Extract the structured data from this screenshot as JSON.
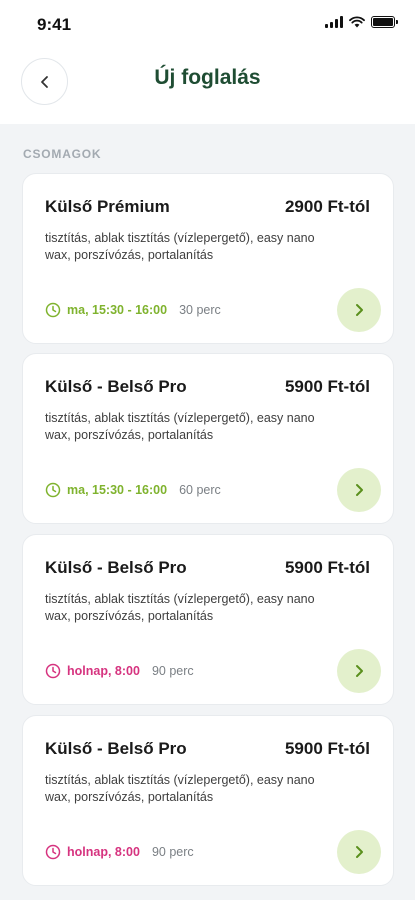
{
  "status_bar": {
    "time": "9:41"
  },
  "header": {
    "title": "Új foglalás"
  },
  "section": {
    "label": "CSOMAGOK"
  },
  "colors": {
    "accent_green": "#7fb32e",
    "accent_pink": "#d6337f",
    "title_green": "#1f4d33",
    "button_bg": "#e3f0cc"
  },
  "packages": [
    {
      "name": "Külső Prémium",
      "price": "2900 Ft-tól",
      "description": "tisztítás, ablak tisztítás (vízlepergető), easy nano wax, porszívózás, portalanítás",
      "when": "ma, 15:30 - 16:00",
      "duration": "30 perc",
      "status": "green"
    },
    {
      "name": "Külső - Belső Pro",
      "price": "5900 Ft-tól",
      "description": "tisztítás, ablak tisztítás (vízlepergető), easy nano wax, porszívózás, portalanítás",
      "when": "ma, 15:30 - 16:00",
      "duration": "60 perc",
      "status": "green"
    },
    {
      "name": "Külső - Belső Pro",
      "price": "5900 Ft-tól",
      "description": "tisztítás, ablak tisztítás (vízlepergető), easy nano wax, porszívózás, portalanítás",
      "when": "holnap, 8:00",
      "duration": "90 perc",
      "status": "pink"
    },
    {
      "name": "Külső - Belső Pro",
      "price": "5900 Ft-tól",
      "description": "tisztítás, ablak tisztítás (vízlepergető), easy nano wax, porszívózás, portalanítás",
      "when": "holnap, 8:00",
      "duration": "90 perc",
      "status": "pink"
    }
  ]
}
